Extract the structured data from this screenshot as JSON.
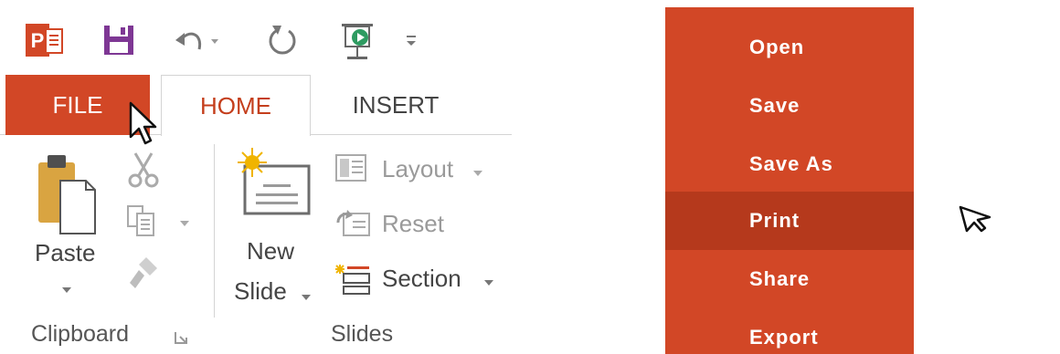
{
  "quick_access": {
    "app_icon_letter": "P",
    "items": [
      "powerpoint-app",
      "save",
      "undo",
      "undo-dropdown",
      "redo",
      "start-from-beginning",
      "customize-quick-access-toolbar"
    ]
  },
  "tabs": [
    {
      "label": "FILE",
      "active": false
    },
    {
      "label": "HOME",
      "active": true
    },
    {
      "label": "INSERT",
      "active": false
    }
  ],
  "clipboard": {
    "paste_label": "Paste",
    "group_label": "Clipboard"
  },
  "slides": {
    "new_slide_line1": "New",
    "new_slide_line2": "Slide",
    "layout_label": "Layout",
    "reset_label": "Reset",
    "section_label": "Section",
    "group_label": "Slides"
  },
  "backstage_menu": {
    "items": [
      {
        "label": "Open",
        "selected": false
      },
      {
        "label": "Save",
        "selected": false
      },
      {
        "label": "Save As",
        "selected": false
      },
      {
        "label": "Print",
        "selected": true
      },
      {
        "label": "Share",
        "selected": false
      },
      {
        "label": "Export",
        "selected": false
      }
    ]
  },
  "colors": {
    "accent": "#d24726",
    "accent_dark": "#b5391c",
    "save_icon": "#7e3794",
    "home_tab_text": "#c43e1c",
    "text": "#444444"
  }
}
